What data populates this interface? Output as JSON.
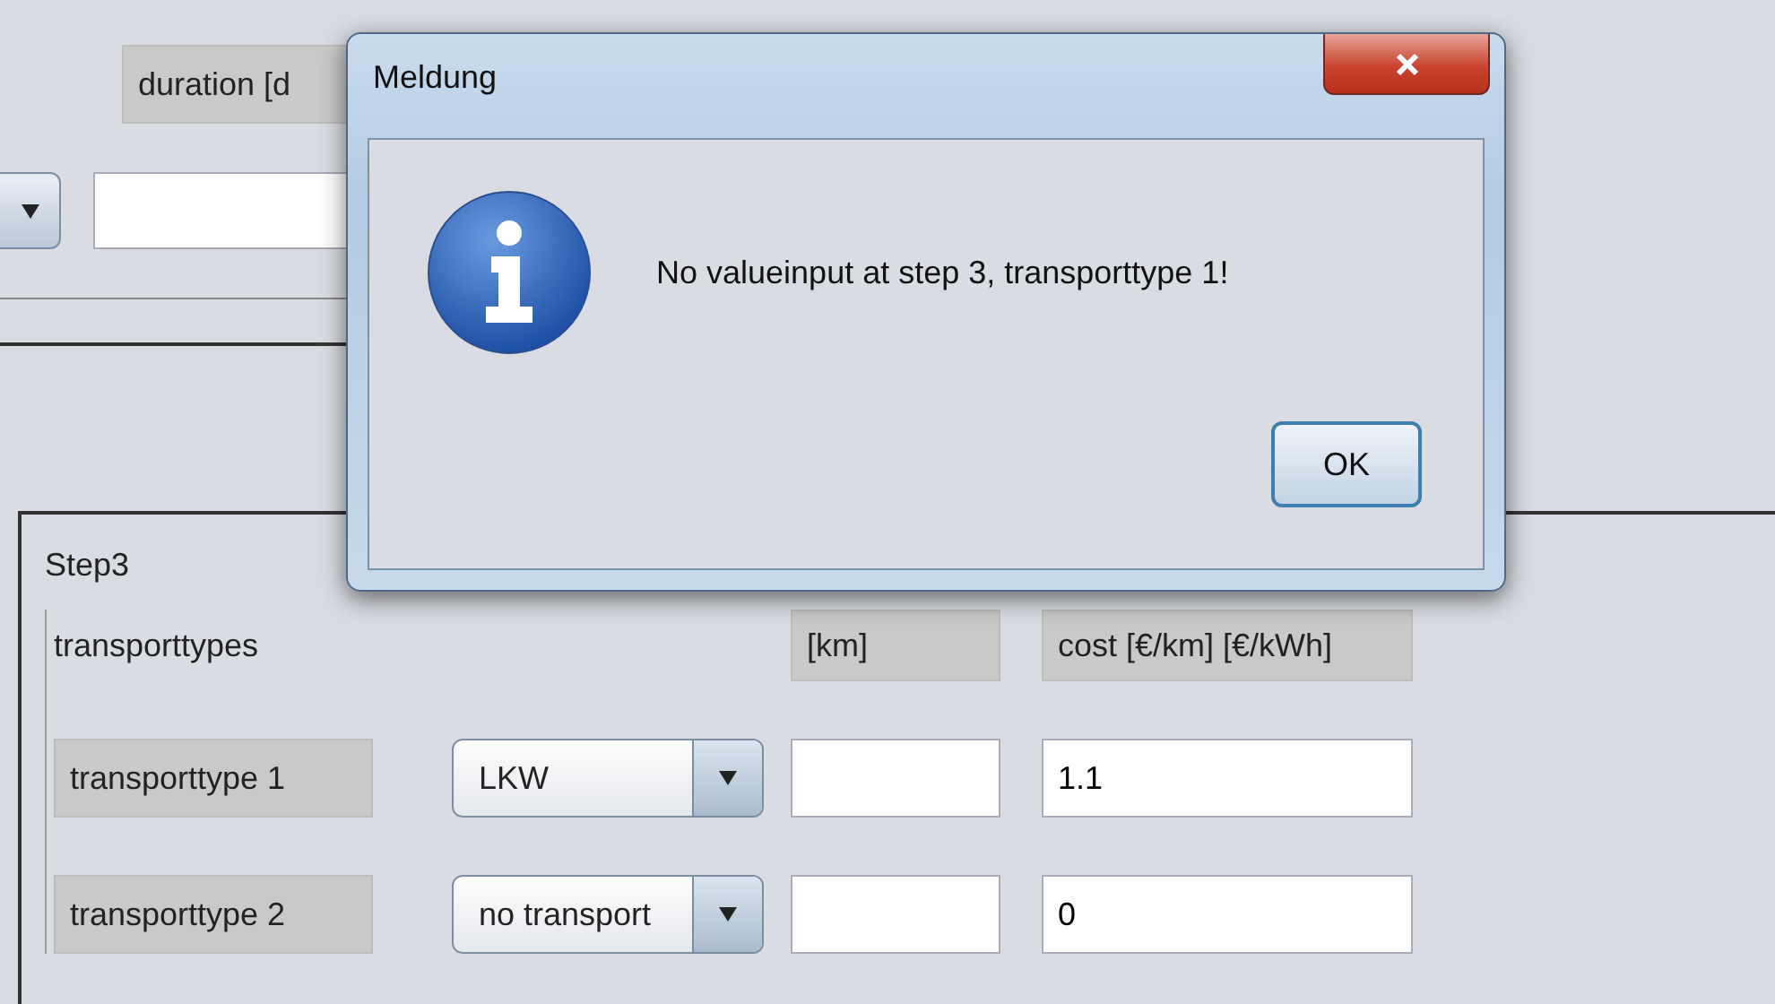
{
  "form": {
    "duration_label": "duration [d",
    "step": {
      "title": "Step3",
      "header": {
        "label": "transporttypes",
        "column_1": "[km]",
        "column_2": "cost [€/km] [€/kWh]"
      },
      "rows": [
        {
          "label": "transporttype 1",
          "choice": "LKW",
          "cost": "1.1"
        },
        {
          "label": "transporttype 2",
          "choice": "no transport",
          "cost": "0"
        }
      ]
    }
  },
  "dialog": {
    "title": "Meldung",
    "message": "No valueinput at step 3, transporttype 1!",
    "buttons": [
      "OK"
    ]
  }
}
